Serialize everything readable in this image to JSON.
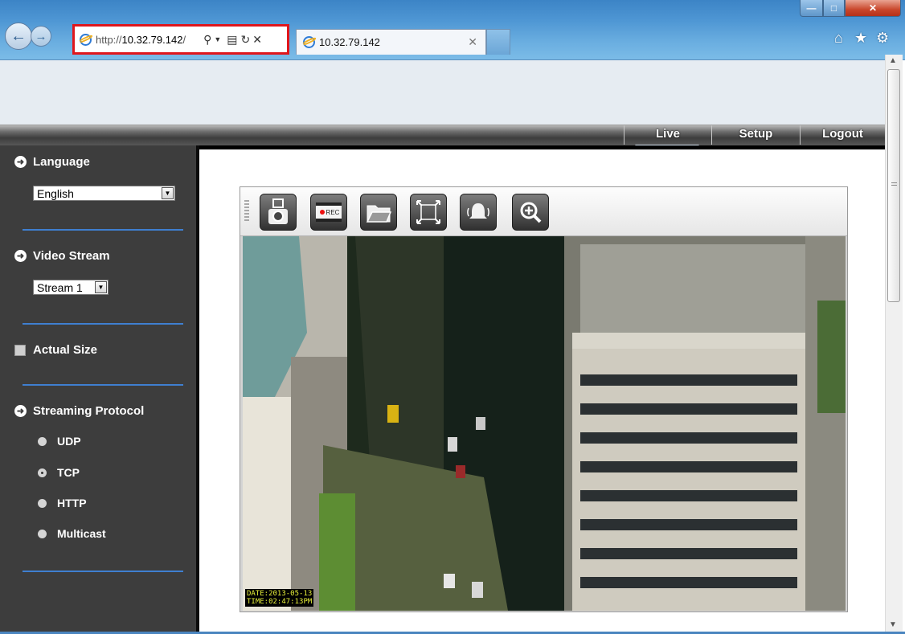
{
  "browser": {
    "address": {
      "prefix": "http://",
      "host": "10.32.79.142",
      "suffix": "/"
    },
    "tab_title": "10.32.79.142",
    "icons": [
      "back-icon",
      "forward-icon",
      "search-icon",
      "compat-icon",
      "refresh-icon",
      "stop-icon",
      "home-icon",
      "star-icon",
      "gear-icon"
    ]
  },
  "nav": {
    "live": "Live",
    "setup": "Setup",
    "logout": "Logout"
  },
  "sidebar": {
    "language": {
      "title": "Language",
      "selected": "English"
    },
    "video_stream": {
      "title": "Video Stream",
      "selected": "Stream 1"
    },
    "actual_size": {
      "label": "Actual Size",
      "checked": false
    },
    "protocol": {
      "title": "Streaming Protocol",
      "options": [
        {
          "label": "UDP",
          "selected": false
        },
        {
          "label": "TCP",
          "selected": true
        },
        {
          "label": "HTTP",
          "selected": false
        },
        {
          "label": "Multicast",
          "selected": false
        }
      ]
    }
  },
  "video": {
    "toolbar": [
      "snapshot-icon",
      "record-icon",
      "folder-icon",
      "fullscreen-icon",
      "alarm-icon",
      "zoom-icon"
    ],
    "record_badge": "REC",
    "timestamp_date": "DATE:2013-05-13",
    "timestamp_time": "TIME:02:47:13PM"
  },
  "colors": {
    "sidebar_bg": "#3d3d3d",
    "separator": "#3f7fd0",
    "highlight_box": "#e0161c"
  }
}
